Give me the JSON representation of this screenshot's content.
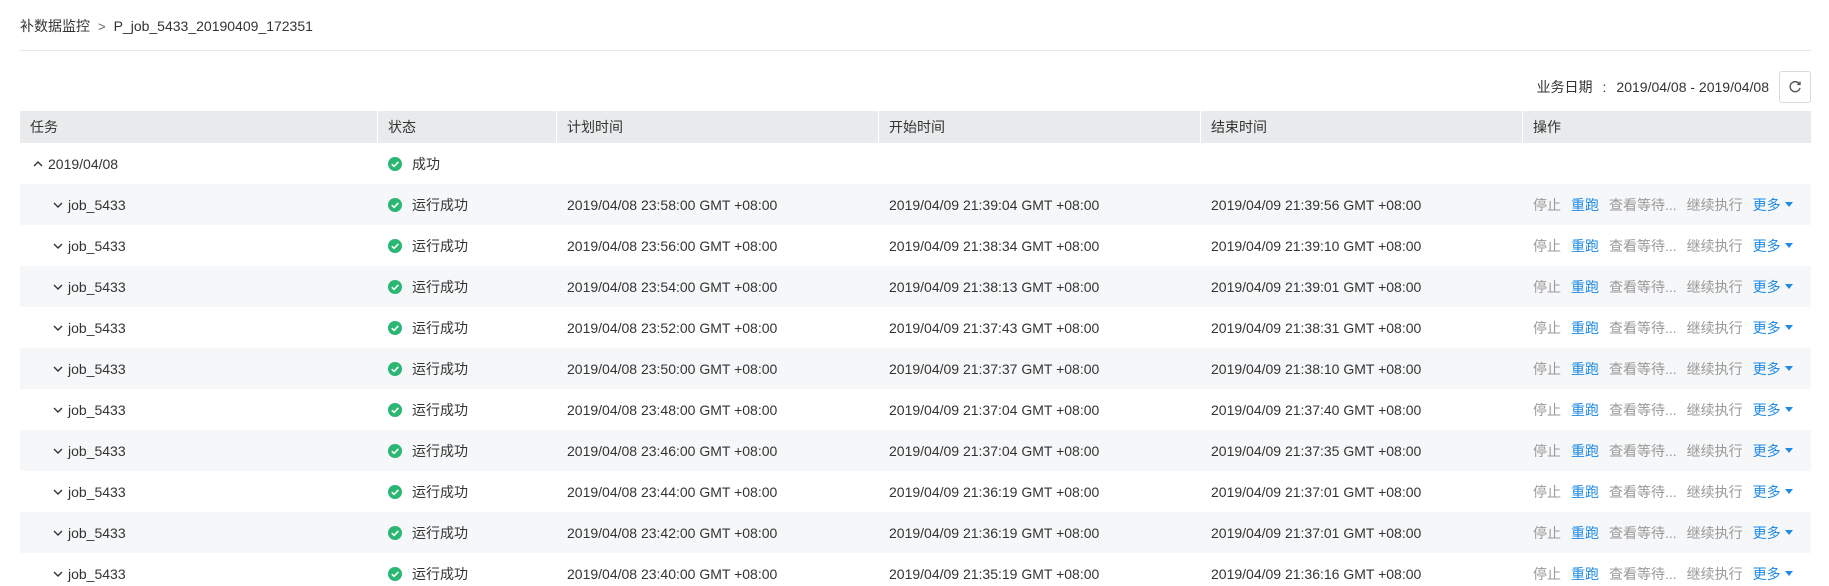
{
  "breadcrumb": {
    "parent": "补数据监控",
    "separator": ">",
    "current": "P_job_5433_20190409_172351"
  },
  "toolbar": {
    "date_label": "业务日期",
    "colon": ":",
    "date_range": "2019/04/08 - 2019/04/08"
  },
  "table": {
    "headers": [
      "任务",
      "状态",
      "计划时间",
      "开始时间",
      "结束时间",
      "操作"
    ],
    "group": {
      "label": "2019/04/08",
      "status": "成功"
    },
    "operations": {
      "stop": "停止",
      "rerun": "重跑",
      "view_waiting": "查看等待...",
      "continue": "继续执行",
      "more": "更多"
    },
    "rows": [
      {
        "task": "job_5433",
        "status": "运行成功",
        "planned": "2019/04/08 23:58:00 GMT +08:00",
        "start": "2019/04/09 21:39:04 GMT +08:00",
        "end": "2019/04/09 21:39:56 GMT +08:00"
      },
      {
        "task": "job_5433",
        "status": "运行成功",
        "planned": "2019/04/08 23:56:00 GMT +08:00",
        "start": "2019/04/09 21:38:34 GMT +08:00",
        "end": "2019/04/09 21:39:10 GMT +08:00"
      },
      {
        "task": "job_5433",
        "status": "运行成功",
        "planned": "2019/04/08 23:54:00 GMT +08:00",
        "start": "2019/04/09 21:38:13 GMT +08:00",
        "end": "2019/04/09 21:39:01 GMT +08:00"
      },
      {
        "task": "job_5433",
        "status": "运行成功",
        "planned": "2019/04/08 23:52:00 GMT +08:00",
        "start": "2019/04/09 21:37:43 GMT +08:00",
        "end": "2019/04/09 21:38:31 GMT +08:00"
      },
      {
        "task": "job_5433",
        "status": "运行成功",
        "planned": "2019/04/08 23:50:00 GMT +08:00",
        "start": "2019/04/09 21:37:37 GMT +08:00",
        "end": "2019/04/09 21:38:10 GMT +08:00"
      },
      {
        "task": "job_5433",
        "status": "运行成功",
        "planned": "2019/04/08 23:48:00 GMT +08:00",
        "start": "2019/04/09 21:37:04 GMT +08:00",
        "end": "2019/04/09 21:37:40 GMT +08:00"
      },
      {
        "task": "job_5433",
        "status": "运行成功",
        "planned": "2019/04/08 23:46:00 GMT +08:00",
        "start": "2019/04/09 21:37:04 GMT +08:00",
        "end": "2019/04/09 21:37:35 GMT +08:00"
      },
      {
        "task": "job_5433",
        "status": "运行成功",
        "planned": "2019/04/08 23:44:00 GMT +08:00",
        "start": "2019/04/09 21:36:19 GMT +08:00",
        "end": "2019/04/09 21:37:01 GMT +08:00"
      },
      {
        "task": "job_5433",
        "status": "运行成功",
        "planned": "2019/04/08 23:42:00 GMT +08:00",
        "start": "2019/04/09 21:36:19 GMT +08:00",
        "end": "2019/04/09 21:37:01 GMT +08:00"
      },
      {
        "task": "job_5433",
        "status": "运行成功",
        "planned": "2019/04/08 23:40:00 GMT +08:00",
        "start": "2019/04/09 21:35:19 GMT +08:00",
        "end": "2019/04/09 21:36:16 GMT +08:00"
      }
    ]
  },
  "colors": {
    "success": "#2bb673",
    "link": "#1e8ae6",
    "muted": "#999999",
    "header_bg": "#e8eaeb"
  },
  "icons": {
    "refresh": "refresh-icon",
    "expand": "chevron-up-icon",
    "collapse": "chevron-down-icon",
    "success": "check-circle-icon",
    "more": "caret-down-icon"
  }
}
